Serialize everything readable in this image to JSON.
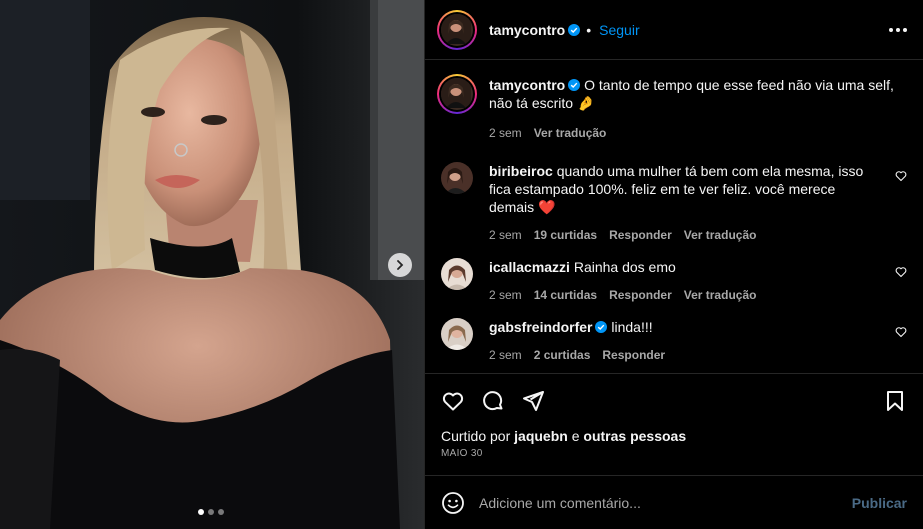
{
  "post": {
    "author": "tamycontro",
    "follow_label": "Seguir",
    "more_icon": "more-horizontal-icon",
    "verified_icon": "verified-badge-icon",
    "carousel_dots": 3,
    "active_dot": 0
  },
  "caption": {
    "username": "tamycontro",
    "text": "O tanto de tempo que esse feed não via uma self, não tá escrito 🤌",
    "time": "2 sem",
    "translate": "Ver tradução"
  },
  "comments": [
    {
      "username": "biribeiroc",
      "verified": false,
      "text": "quando uma mulher tá bem com ela mesma, isso fica estampado 100%. feliz em te ver feliz. você merece demais ❤️",
      "time": "2 sem",
      "likes": "19 curtidas",
      "reply": "Responder",
      "translate": "Ver tradução"
    },
    {
      "username": "icallacmazzi",
      "verified": false,
      "text": "Rainha dos emo",
      "time": "2 sem",
      "likes": "14 curtidas",
      "reply": "Responder",
      "translate": "Ver tradução"
    },
    {
      "username": "gabsfreindorfer",
      "verified": true,
      "text": "linda!!!",
      "time": "2 sem",
      "likes": "2 curtidas",
      "reply": "Responder",
      "translate": ""
    }
  ],
  "actions": {
    "liked_by_prefix": "Curtido por",
    "liked_by_user": "jaquebn",
    "liked_by_conj": "e",
    "liked_by_others": "outras pessoas",
    "date": "MAIO 30"
  },
  "add_comment": {
    "placeholder": "Adicione um comentário...",
    "publish": "Publicar"
  },
  "colors": {
    "accent": "#0095f6",
    "background": "#000000",
    "border": "#262626",
    "muted_text": "#a8a8a8",
    "heart_red": "#ff3040"
  }
}
